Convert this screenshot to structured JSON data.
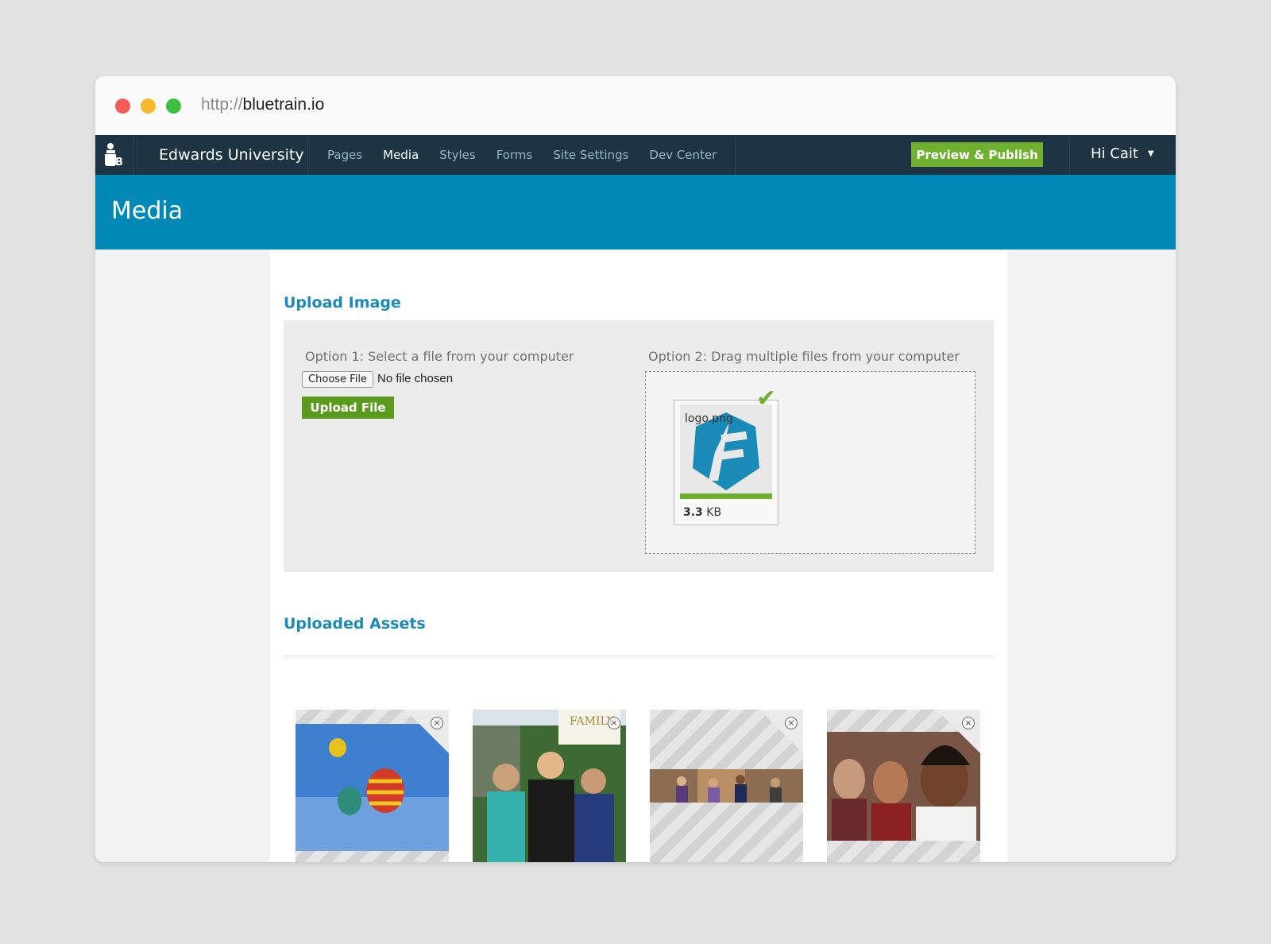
{
  "browser": {
    "url_protocol": "http://",
    "url_host": "bluetrain.io"
  },
  "navbar": {
    "site_name": "Edwards University",
    "items": [
      {
        "label": "Pages"
      },
      {
        "label": "Media"
      },
      {
        "label": "Styles"
      },
      {
        "label": "Forms"
      },
      {
        "label": "Site Settings"
      },
      {
        "label": "Dev Center"
      }
    ],
    "active_item": "Media",
    "publish_label": "Preview & Publish",
    "user_greeting": "Hi Cait"
  },
  "page": {
    "title": "Media"
  },
  "upload": {
    "section_title": "Upload Image",
    "option1_label": "Option 1: Select a file from your computer",
    "choose_file_label": "Choose File",
    "no_file_text": "No file chosen",
    "upload_button_label": "Upload File",
    "option2_label": "Option 2: Drag multiple files from your computer",
    "dropped_file": {
      "name": "logo.png",
      "size_value": "3.3",
      "size_unit": "KB",
      "progress": 1.0,
      "status": "complete"
    }
  },
  "assets": {
    "section_title": "Uploaded Assets",
    "items": [
      {
        "label": "hot-air-balloons"
      },
      {
        "label": "family-group-photo"
      },
      {
        "label": "students-panorama"
      },
      {
        "label": "smiling-people"
      }
    ],
    "family_caption": "FAMILY"
  },
  "colors": {
    "nav_bg": "#1e3442",
    "header_bg": "#0089b7",
    "accent_green": "#6fb02f",
    "section_title": "#1a8ab8"
  }
}
